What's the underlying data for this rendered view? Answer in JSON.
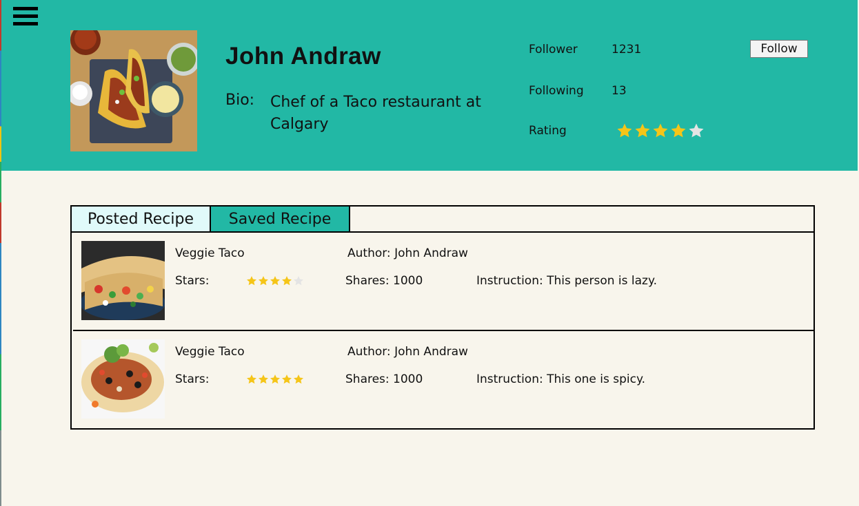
{
  "profile": {
    "name": "John Andraw",
    "bio_label": "Bio:",
    "bio_text": "Chef of a Taco restaurant at Calgary",
    "follower_label": "Follower",
    "follower_count": "1231",
    "following_label": "Following",
    "following_count": "13",
    "rating_label": "Rating",
    "rating_value": 4,
    "rating_max": 5,
    "follow_button": "Follow"
  },
  "tabs": [
    {
      "label": "Posted Recipe",
      "active": true
    },
    {
      "label": "Saved Recipe",
      "active": false
    }
  ],
  "recipes": [
    {
      "title": "Veggie Taco",
      "author": "Author: John Andraw",
      "stars_label": "Stars:",
      "stars": 4,
      "shares": "Shares: 1000",
      "instruction": "Instruction: This person is lazy."
    },
    {
      "title": "Veggie Taco",
      "author": "Author: John Andraw",
      "stars_label": "Stars:",
      "stars": 5,
      "shares": "Shares: 1000",
      "instruction": "Instruction: This one is spicy."
    }
  ],
  "colors": {
    "header_bg": "#22b8a5",
    "page_bg": "#f8f5ec",
    "star_filled": "#f5c518",
    "star_empty": "#e4e4e4",
    "tab_posted_bg": "#e0fafa",
    "tab_saved_bg": "#22b8a5"
  },
  "icons": {
    "menu": "hamburger-menu-icon",
    "star": "star-icon"
  }
}
